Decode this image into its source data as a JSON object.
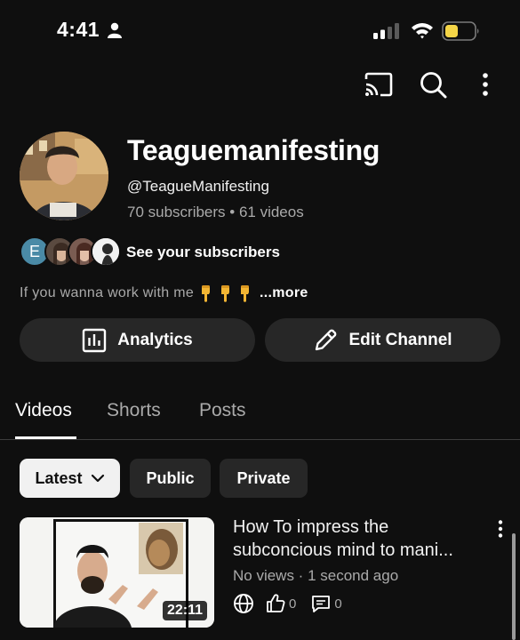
{
  "status_bar": {
    "time": "4:41",
    "icons": [
      "person-icon",
      "signal-icon",
      "wifi-icon",
      "battery-icon"
    ],
    "battery_color": "#f5d547"
  },
  "top_bar": {
    "icons": [
      "cast-icon",
      "search-icon",
      "more-vert-icon"
    ]
  },
  "channel": {
    "name": "Teaguemanifesting",
    "handle": "@TeagueManifesting",
    "stats": "70 subscribers • 61 videos",
    "subscribers_link": "See your subscribers",
    "subscriber_initial": "E",
    "description": "If you wanna work with me",
    "description_emoji": "backhand-index-pointing-down x3",
    "more_label": "...more"
  },
  "actions": {
    "analytics_label": "Analytics",
    "edit_label": "Edit Channel"
  },
  "tabs": [
    {
      "label": "Videos",
      "active": true
    },
    {
      "label": "Shorts",
      "active": false
    },
    {
      "label": "Posts",
      "active": false
    }
  ],
  "filters": {
    "latest_label": "Latest",
    "public_label": "Public",
    "private_label": "Private"
  },
  "videos": [
    {
      "title_line1": "How To impress the",
      "title_line2": "subconcious mind to mani...",
      "meta": "No views · 1 second ago",
      "duration": "22:11",
      "likes": "0",
      "comments": "0",
      "visibility_icon": "globe-icon"
    }
  ],
  "colors": {
    "background": "#0f0f0f",
    "button_bg": "#272727",
    "secondary_text": "#aaaaaa",
    "chip_selected": "#f1f1f1"
  }
}
